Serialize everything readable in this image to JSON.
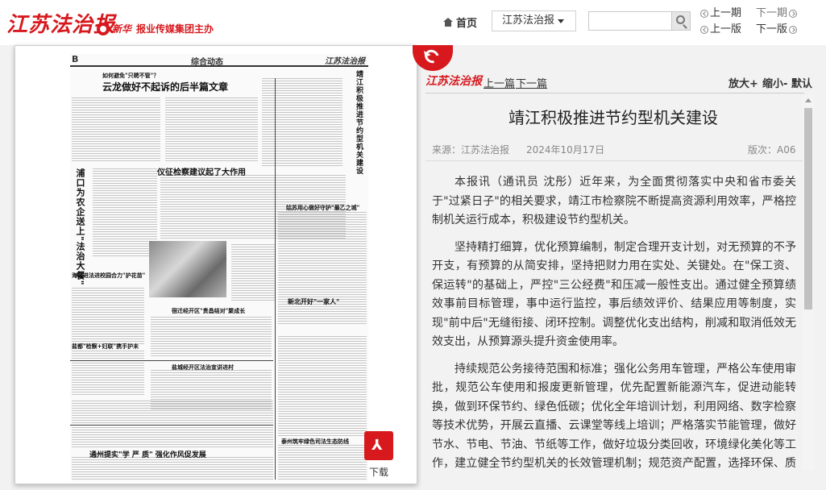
{
  "header": {
    "logo_text": "江苏法治报",
    "group_brand": "新华",
    "group_text": "报业传媒集团主办",
    "home_label": "首页",
    "paper_select": "江苏法治报",
    "search": {
      "value": "",
      "placeholder": ""
    },
    "prev_issue": "上一期",
    "next_issue": "下一期",
    "prev_page": "上一版",
    "next_page": "下一版"
  },
  "newspaper": {
    "page_letter": "B",
    "section": "综合动态",
    "masthead": "江苏法治报",
    "headlines": [
      "如何避免\"只聘不管\"？",
      "云龙做好不起诉的后半篇文章",
      "仪征检察建议起了大作用",
      "靖江积极推进节约型机关建设",
      "浦口为农企送上\"法治大餐\"",
      "姑苏用心做好守护\"最乙之城\"",
      "海门进法进校园合力\"护花苗\"",
      "新北开好\"一家人\"",
      "宿迁经开区\"贵昌结对\"聚成长",
      "盐都\"检察+妇联\"携手护未",
      "盐城经开区法治宣讲进村",
      "通州提实\"学 严 质\" 强化作风促发展",
      "泰州筑牢绿色司法生态防线"
    ],
    "download_label": "下载"
  },
  "article": {
    "logo_text": "江苏法治报",
    "prev_label": "上一篇",
    "next_label": "下一篇",
    "zoom_in": "放大+",
    "zoom_out": "缩小-",
    "zoom_reset": "默认",
    "title": "靖江积极推进节约型机关建设",
    "source": "来源：江苏法治报",
    "date": "2024年10月17日",
    "edition": "版次：A06",
    "paragraphs": [
      "本报讯（通讯员 沈彤）近年来，为全面贯彻落实中央和省市委关于\"过紧日子\"的相关要求，靖江市检察院不断提高资源利用效率，严格控制机关运行成本，积极建设节约型机关。",
      "坚持精打细算，优化预算编制，制定合理开支计划，对无预算的不予开支，有预算的从简安排，坚持把财力用在实处、关键处。在\"保工资、保运转\"的基础上，严控\"三公经费\"和压减一般性支出。通过健全预算绩效事前目标管理，事中运行监控，事后绩效评价、结果应用等制度，实现\"前中后\"无缝衔接、闭环控制。调整优化支出结构，削减和取消低效无效支出，从预算源头提升资金使用率。",
      "持续规范公务接待范围和标准；强化公务用车管理，严格公车使用审批，规范公车使用和报废更新管理，优先配置新能源汽车，促进动能转换，做到环保节约、绿色低碳；优化全年培训计划，利用网络、数字检察等技术优势，开展云直播、云课堂等线上培训；严格落实节能管理，做好节水、节电、节油、节纸等工作，做好垃圾分类回收，环境绿化美化等工作，建立健全节约型机关的长效管理机制；规范资产配置，选择环保、质优、能耗小的资产设备；建立资产管理台"
    ]
  }
}
